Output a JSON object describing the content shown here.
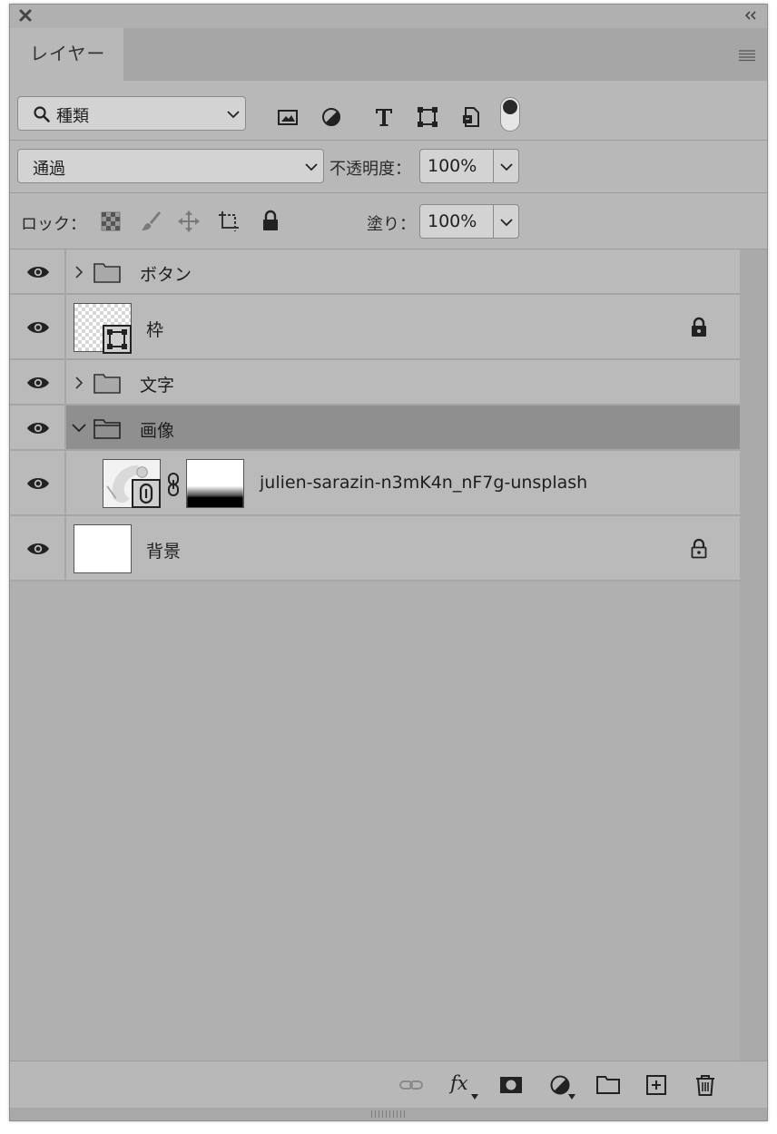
{
  "panel": {
    "tab_label": "レイヤー"
  },
  "filter": {
    "kind_label": "種類",
    "icons": [
      "pixel-layer-filter-icon",
      "adjustment-layer-filter-icon",
      "type-layer-filter-icon",
      "shape-layer-filter-icon",
      "smart-object-filter-icon"
    ],
    "toggle_on": true
  },
  "blend": {
    "mode": "通過",
    "opacity_label": "不透明度：",
    "opacity_value": "100%"
  },
  "lock": {
    "label": "ロック：",
    "icons": [
      "lock-transparent-pixels-icon",
      "lock-image-pixels-icon",
      "lock-position-icon",
      "lock-artboard-icon",
      "lock-all-icon"
    ],
    "fill_label": "塗り：",
    "fill_value": "100%"
  },
  "layers": [
    {
      "name": "ボタン",
      "type": "group",
      "expanded": false,
      "visible": true,
      "locked": false,
      "selected": false
    },
    {
      "name": "枠",
      "type": "shape",
      "visible": true,
      "locked": true,
      "selected": false
    },
    {
      "name": "文字",
      "type": "group",
      "expanded": false,
      "visible": true,
      "locked": false,
      "selected": false
    },
    {
      "name": "画像",
      "type": "group",
      "expanded": true,
      "visible": true,
      "locked": false,
      "selected": true
    },
    {
      "name": "julien-sarazin-n3mK4n_nF7g-unsplash",
      "type": "smart-object-with-mask",
      "visible": true,
      "locked": false,
      "selected": false
    },
    {
      "name": "背景",
      "type": "background",
      "visible": true,
      "locked": true,
      "selected": false
    }
  ],
  "bottom_icons": [
    "link-layers-icon",
    "fx-icon",
    "add-mask-icon",
    "new-adjustment-layer-icon",
    "new-group-icon",
    "new-layer-icon",
    "delete-layer-icon"
  ],
  "bottom": {
    "fx_label": "fx"
  },
  "colors": {
    "panel_bg": "#b8b8b8",
    "selected_row": "#8f8f8f"
  }
}
